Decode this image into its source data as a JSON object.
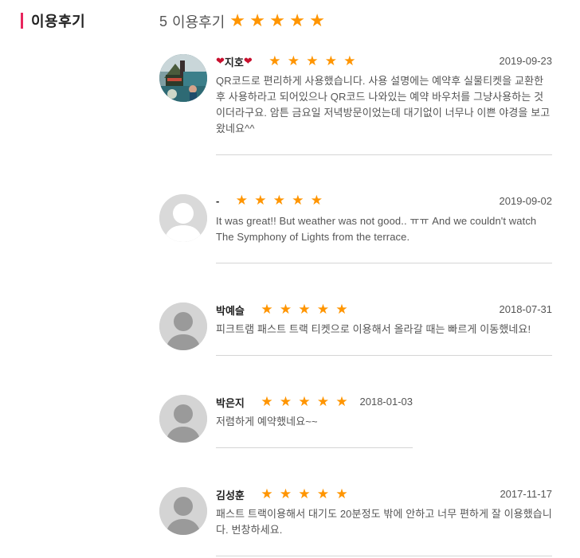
{
  "header": {
    "title": "이용후기"
  },
  "summary": {
    "count": "5",
    "label": "이용후기",
    "rating": 5
  },
  "reviews": [
    {
      "name": "지호",
      "hearts": true,
      "rating": 5,
      "date": "2019-09-23",
      "avatar": "photo",
      "text": "QR코드로 편리하게 사용했습니다. 사용 설명에는 예약후 실물티켓을 교환한 후 사용하라고 되어있으나 QR코드 나와있는 예약 바우처를 그냥사용하는 것이더라구요. 암튼 금요일 저녁방문이었는데 대기없이 너무나 이쁜 야경을 보고 왔네요^^"
    },
    {
      "name": "-",
      "hearts": false,
      "rating": 5,
      "date": "2019-09-02",
      "avatar": "default",
      "text": "It was great!! But weather was not good.. ㅠㅠ And we couldn't watch The Symphony of Lights from the terrace."
    },
    {
      "name": "박예슬",
      "hearts": false,
      "rating": 5,
      "date": "2018-07-31",
      "avatar": "default",
      "text": "피크트램 패스트 트랙 티켓으로 이용해서 올라갈 때는 빠르게 이동했네요!"
    },
    {
      "name": "박은지",
      "hearts": false,
      "rating": 5,
      "date": "2018-01-03",
      "avatar": "default",
      "text": "저렴하게 예약했네요~~"
    },
    {
      "name": "김성훈",
      "hearts": false,
      "rating": 5,
      "date": "2017-11-17",
      "avatar": "default",
      "text": "패스트 트랙이용해서 대기도 20분정도 밖에 안하고 너무 편하게 잘 이용했습니다. 번창하세요."
    }
  ]
}
